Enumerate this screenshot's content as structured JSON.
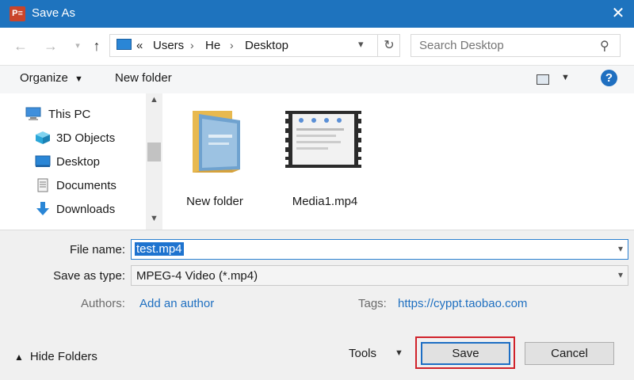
{
  "window": {
    "title": "Save As",
    "app_icon": "P≡"
  },
  "address": {
    "crumbs": [
      "«",
      "Users",
      "He",
      "Desktop"
    ],
    "separators": [
      "›",
      "›"
    ]
  },
  "search": {
    "placeholder": "Search Desktop"
  },
  "toolbar": {
    "organize_label": "Organize",
    "new_folder_label": "New folder"
  },
  "sidebar": {
    "items": [
      {
        "label": "This PC",
        "icon": "computer-icon"
      },
      {
        "label": "3D Objects",
        "icon": "cube-icon"
      },
      {
        "label": "Desktop",
        "icon": "desktop-icon"
      },
      {
        "label": "Documents",
        "icon": "document-icon"
      },
      {
        "label": "Downloads",
        "icon": "download-arrow-icon"
      }
    ]
  },
  "files": [
    {
      "label": "New folder",
      "icon": "folder-icon"
    },
    {
      "label": "Media1.mp4",
      "icon": "video-file-icon"
    }
  ],
  "form": {
    "file_name_label": "File name:",
    "file_name_value": "test.mp4",
    "save_type_label": "Save as type:",
    "save_type_value": "MPEG-4 Video (*.mp4)",
    "authors_label": "Authors:",
    "authors_value": "Add an author",
    "tags_label": "Tags:",
    "tags_value": "https://cyppt.taobao.com"
  },
  "footer": {
    "hide_folders_label": "Hide Folders",
    "tools_label": "Tools",
    "save_label": "Save",
    "cancel_label": "Cancel"
  },
  "colors": {
    "titlebar": "#1e73be",
    "accent": "#1e6fc0",
    "highlight_border": "#d0222a"
  }
}
